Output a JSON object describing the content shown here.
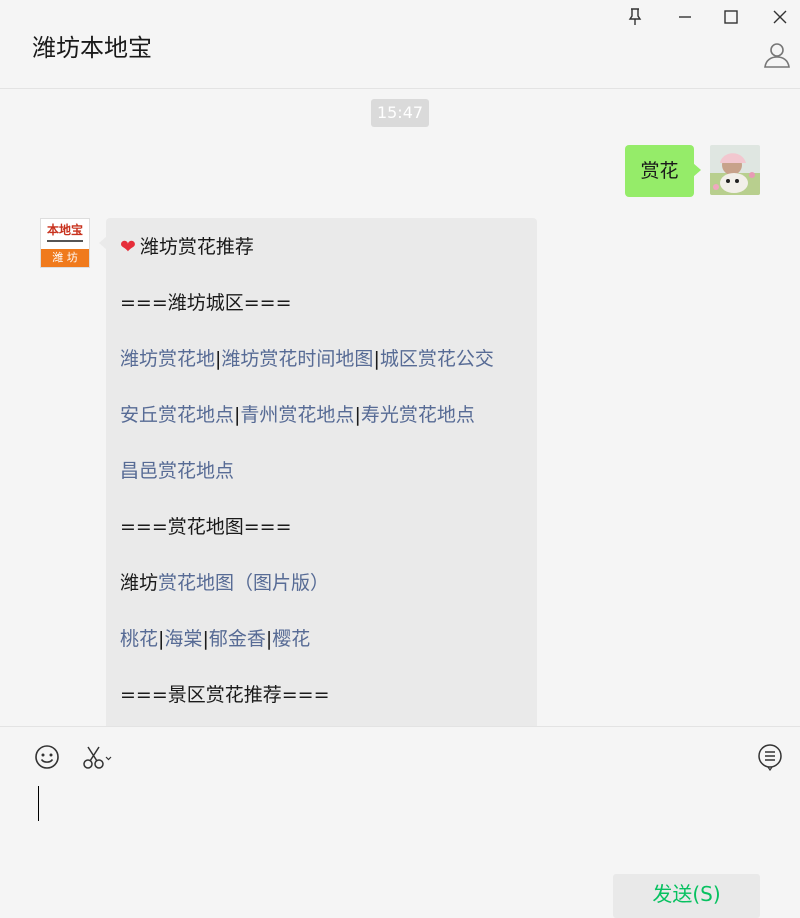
{
  "window": {
    "title": "潍坊本地宝"
  },
  "chat": {
    "timestamp": "15:47",
    "sent_message": "赏花",
    "bot_logo": {
      "top_text": "本地宝",
      "bottom_text": "潍 坊"
    },
    "bot_message": {
      "title": "潍坊赏花推荐",
      "section1": "===潍坊城区===",
      "row1": [
        "潍坊赏花地",
        "潍坊赏花时间地图",
        "城区赏花公交"
      ],
      "row2": [
        "安丘赏花地点",
        "青州赏花地点",
        "寿光赏花地点"
      ],
      "row3": "昌邑赏花地点",
      "section2": "===赏花地图===",
      "map_prefix": "潍坊",
      "map_link": "赏花地图（图片版）",
      "row4": [
        "桃花",
        "海棠",
        "郁金香",
        "樱花"
      ],
      "section3": "===景区赏花推荐==="
    }
  },
  "input": {
    "send_label": "发送(S)"
  },
  "icons": [
    "pin-icon",
    "minimize-icon",
    "maximize-icon",
    "close-icon",
    "person-icon",
    "emoji-icon",
    "scissors-icon",
    "chat-history-icon"
  ],
  "colors": {
    "my_bubble": "#95ec69",
    "link": "#576b95",
    "send_text": "#07c160"
  }
}
